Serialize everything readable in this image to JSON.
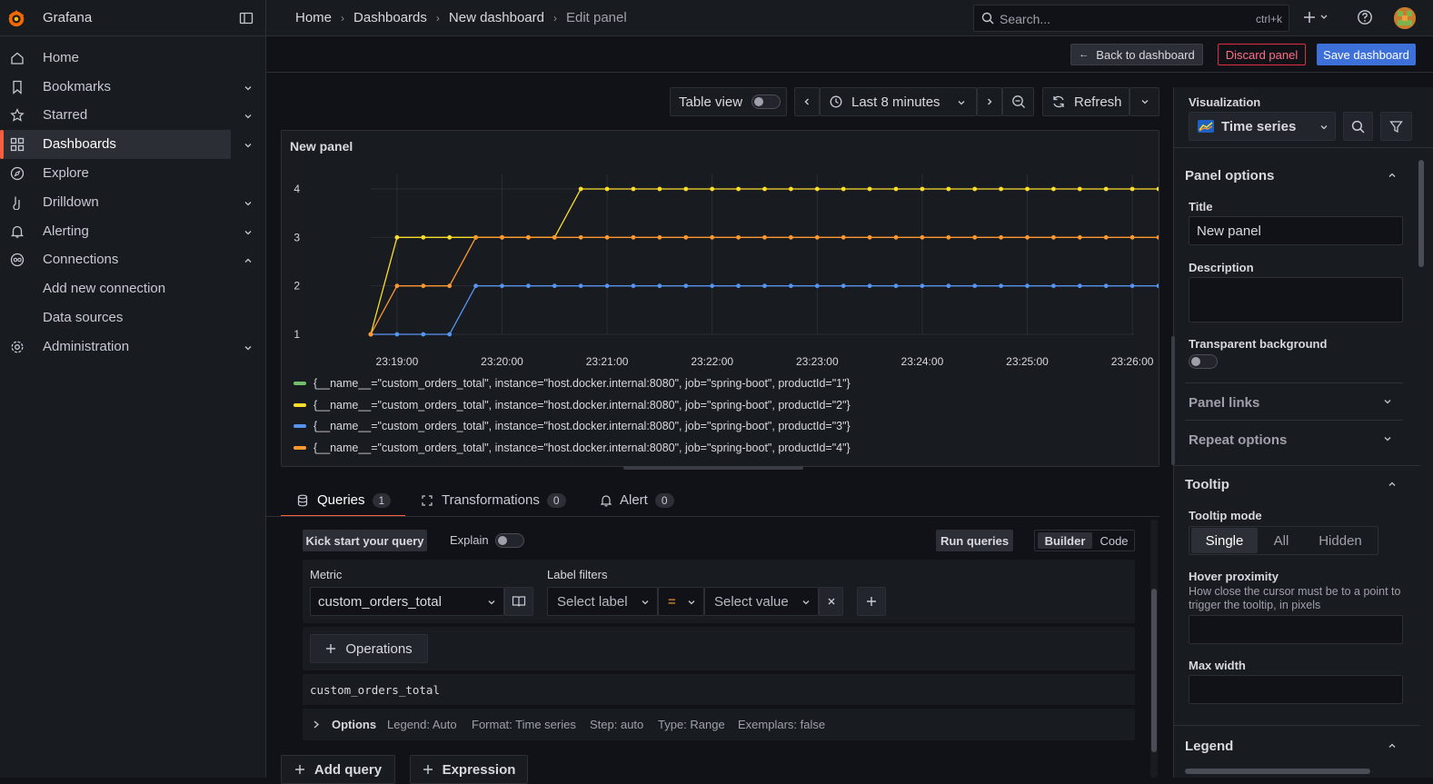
{
  "app": {
    "brand": "Grafana"
  },
  "breadcrumbs": [
    "Home",
    "Dashboards",
    "New dashboard",
    "Edit panel"
  ],
  "search": {
    "placeholder": "Search...",
    "shortcut": "ctrl+k"
  },
  "sidebar": {
    "items": [
      {
        "label": "Home",
        "icon": "home-icon"
      },
      {
        "label": "Bookmarks",
        "icon": "bookmark-icon"
      },
      {
        "label": "Starred",
        "icon": "star-icon"
      },
      {
        "label": "Dashboards",
        "icon": "apps-icon"
      },
      {
        "label": "Explore",
        "icon": "compass-icon"
      },
      {
        "label": "Drilldown",
        "icon": "drilldown-icon"
      },
      {
        "label": "Alerting",
        "icon": "bell-icon"
      },
      {
        "label": "Connections",
        "icon": "connections-icon"
      },
      {
        "label": "Add new connection"
      },
      {
        "label": "Data sources"
      },
      {
        "label": "Administration",
        "icon": "gear-icon"
      }
    ]
  },
  "actions": {
    "back": "Back to dashboard",
    "discard": "Discard panel",
    "save": "Save dashboard"
  },
  "toolbar": {
    "table_view": "Table view",
    "time_range": "Last 8 minutes",
    "refresh": "Refresh"
  },
  "panel": {
    "title": "New panel"
  },
  "chart_data": {
    "type": "line",
    "x": [
      "23:18:45",
      "23:19:00",
      "23:19:15",
      "23:19:30",
      "23:19:45",
      "23:20:00",
      "23:20:15",
      "23:20:30",
      "23:20:45",
      "23:21:00",
      "23:21:15",
      "23:21:30",
      "23:21:45",
      "23:22:00",
      "23:22:15",
      "23:22:30",
      "23:22:45",
      "23:23:00",
      "23:23:15",
      "23:23:30",
      "23:23:45",
      "23:24:00",
      "23:24:15",
      "23:24:30",
      "23:24:45",
      "23:25:00",
      "23:25:15",
      "23:25:30",
      "23:25:45",
      "23:26:00",
      "23:26:15"
    ],
    "x_ticks": [
      "23:19:00",
      "23:20:00",
      "23:21:00",
      "23:22:00",
      "23:23:00",
      "23:24:00",
      "23:25:00",
      "23:26:00"
    ],
    "y_ticks": [
      1,
      2,
      3,
      4
    ],
    "ylim": [
      1,
      4
    ],
    "grid": true,
    "legend": "bottom",
    "series": [
      {
        "name": "{__name__=\"custom_orders_total\", instance=\"host.docker.internal:8080\", job=\"spring-boot\", productId=\"1\"}",
        "color": "#73bf69",
        "values": []
      },
      {
        "name": "{__name__=\"custom_orders_total\", instance=\"host.docker.internal:8080\", job=\"spring-boot\", productId=\"2\"}",
        "color": "#fade2a",
        "values": [
          1,
          3,
          3,
          3,
          3,
          3,
          3,
          3,
          4,
          4,
          4,
          4,
          4,
          4,
          4,
          4,
          4,
          4,
          4,
          4,
          4,
          4,
          4,
          4,
          4,
          4,
          4,
          4,
          4,
          4,
          4
        ]
      },
      {
        "name": "{__name__=\"custom_orders_total\", instance=\"host.docker.internal:8080\", job=\"spring-boot\", productId=\"3\"}",
        "color": "#5794f2",
        "values": [
          1,
          1,
          1,
          1,
          2,
          2,
          2,
          2,
          2,
          2,
          2,
          2,
          2,
          2,
          2,
          2,
          2,
          2,
          2,
          2,
          2,
          2,
          2,
          2,
          2,
          2,
          2,
          2,
          2,
          2,
          2
        ]
      },
      {
        "name": "{__name__=\"custom_orders_total\", instance=\"host.docker.internal:8080\", job=\"spring-boot\", productId=\"4\"}",
        "color": "#ff9830",
        "values": [
          1,
          2,
          2,
          2,
          3,
          3,
          3,
          3,
          3,
          3,
          3,
          3,
          3,
          3,
          3,
          3,
          3,
          3,
          3,
          3,
          3,
          3,
          3,
          3,
          3,
          3,
          3,
          3,
          3,
          3,
          3
        ]
      }
    ]
  },
  "tabs": [
    {
      "label": "Queries",
      "count": "1"
    },
    {
      "label": "Transformations",
      "count": "0"
    },
    {
      "label": "Alert",
      "count": "0"
    }
  ],
  "query": {
    "kick_start": "Kick start your query",
    "explain": "Explain",
    "run": "Run queries",
    "mode_builder": "Builder",
    "mode_code": "Code",
    "metric_label": "Metric",
    "metric_value": "custom_orders_total",
    "label_filters": "Label filters",
    "select_label": "Select label",
    "operator": "=",
    "select_value": "Select value",
    "operations": "Operations",
    "preview": "custom_orders_total",
    "options_label": "Options",
    "options_summary": [
      "Legend: Auto",
      "Format: Time series",
      "Step: auto",
      "Type: Range",
      "Exemplars: false"
    ],
    "add_query": "Add query",
    "expression": "Expression"
  },
  "right_panel": {
    "visualization_label": "Visualization",
    "visualization_value": "Time series",
    "panel_options": "Panel options",
    "title_label": "Title",
    "title_value": "New panel",
    "description_label": "Description",
    "transparent_label": "Transparent background",
    "panel_links": "Panel links",
    "repeat_options": "Repeat options",
    "tooltip": "Tooltip",
    "tooltip_mode_label": "Tooltip mode",
    "tooltip_modes": [
      "Single",
      "All",
      "Hidden"
    ],
    "hover_label": "Hover proximity",
    "hover_desc": "How close the cursor must be to a point to trigger the tooltip, in pixels",
    "max_width_label": "Max width",
    "legend": "Legend"
  }
}
